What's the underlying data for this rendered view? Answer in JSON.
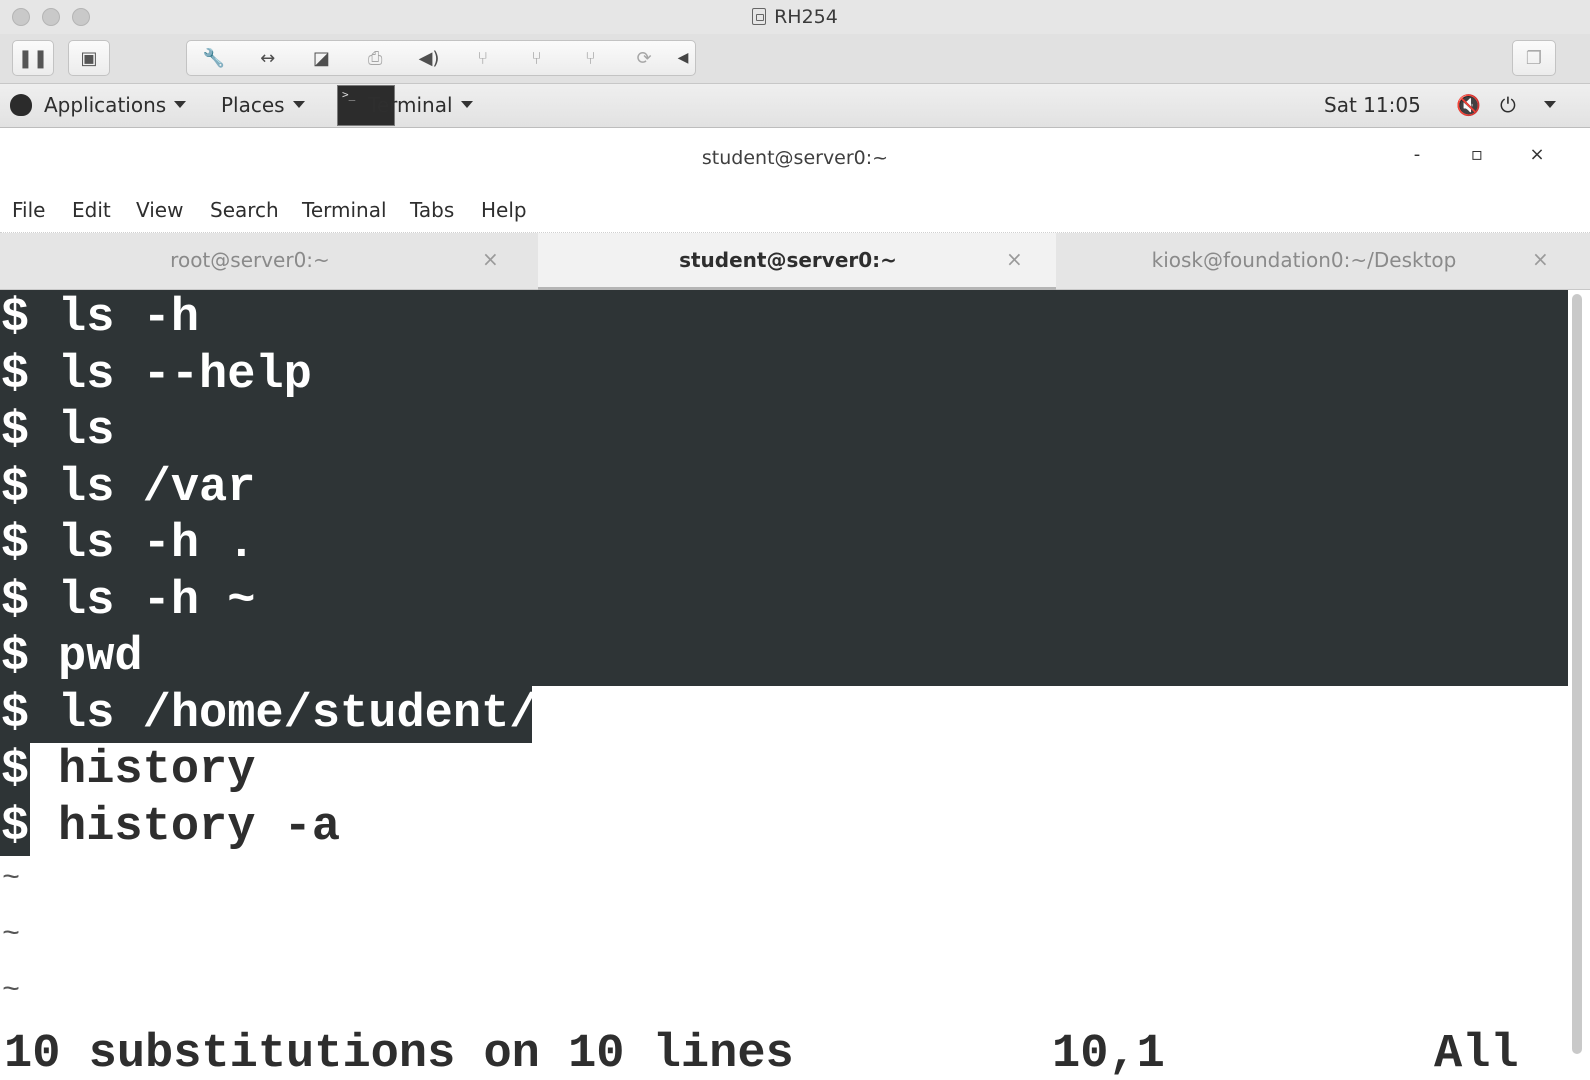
{
  "vm": {
    "title": "RH254",
    "toolbar_icons": [
      "pause-icon",
      "snapshot-icon",
      "wrench-icon",
      "network-icon",
      "disk-icon",
      "printer-icon",
      "speaker-icon",
      "usb-icon",
      "usb-icon",
      "usb-icon",
      "refresh-icon",
      "collapse-arrow-icon",
      "window-icon"
    ]
  },
  "panel": {
    "applications": "Applications",
    "places": "Places",
    "terminal": "Terminal",
    "clock": "Sat 11:05"
  },
  "window": {
    "title": "student@server0:~",
    "minimize": "-",
    "maximize": "▫",
    "close": "×"
  },
  "menu": [
    "File",
    "Edit",
    "View",
    "Search",
    "Terminal",
    "Tabs",
    "Help"
  ],
  "tabs": [
    {
      "label": "root@server0:~",
      "active": false
    },
    {
      "label": "student@server0:~",
      "active": true
    },
    {
      "label": "kiosk@foundation0:~/Desktop",
      "active": false
    }
  ],
  "terminal": {
    "prompt": "$",
    "lines": [
      "ls -h",
      "ls --help",
      "ls",
      "ls /var",
      "ls -h .",
      "ls -h ~",
      "pwd",
      "ls /home/student/",
      "history",
      "history -a"
    ],
    "tilde": "~",
    "status_message": "10 substitutions on 10 lines",
    "cursor_position": "10,1",
    "scroll_position": "All"
  },
  "colors": {
    "terminal_selection": "#2e3436",
    "terminal_fg": "#2e2e2e"
  }
}
